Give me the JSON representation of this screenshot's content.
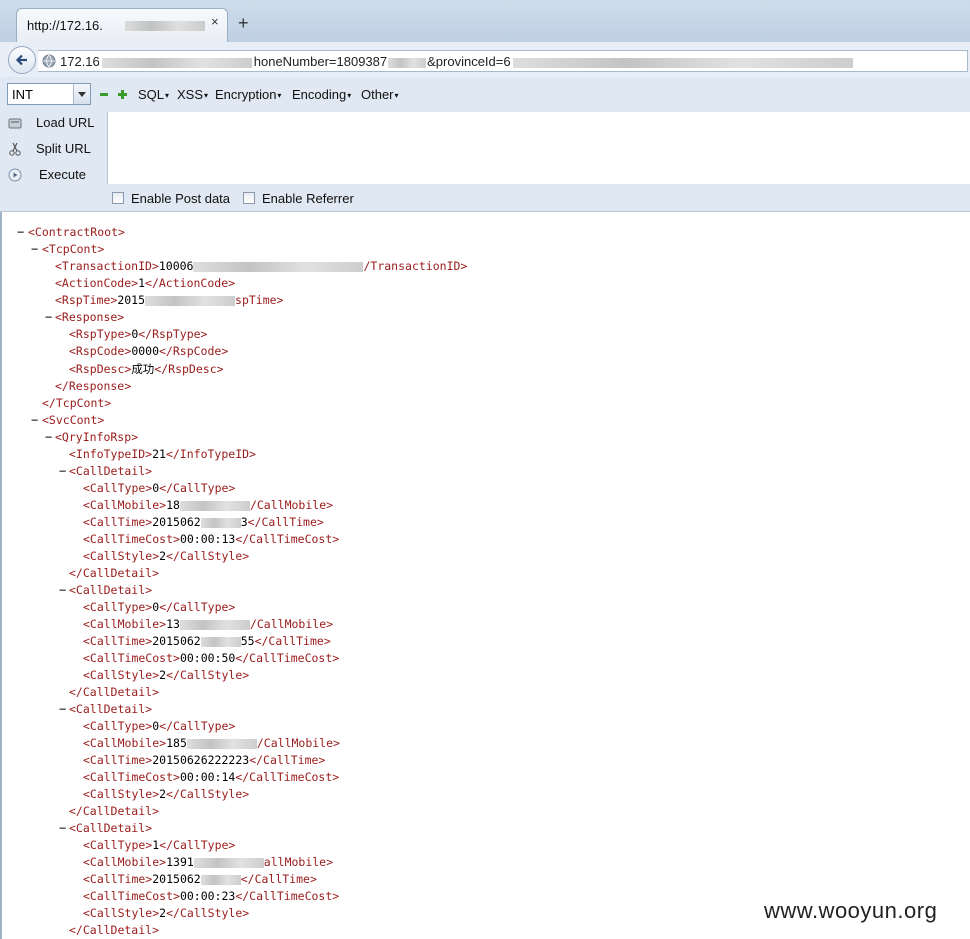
{
  "tab": {
    "title": "http://172.16.",
    "close": "×",
    "new_tab": "+"
  },
  "nav": {
    "url_prefix": "172.16",
    "url_middle": "honeNumber=1809387",
    "url_suffix": "&provinceId=6"
  },
  "hackbar": {
    "select_value": "INT",
    "menus": [
      "SQL",
      "XSS",
      "Encryption",
      "Encoding",
      "Other"
    ],
    "load_url": "Load URL",
    "split_url": "Split URL",
    "execute": "Execute",
    "enable_post": "Enable Post data",
    "enable_referrer": "Enable Referrer"
  },
  "xml": {
    "contract_root_open": "<ContractRoot>",
    "tcp_cont_open": "<TcpCont>",
    "transaction_id": {
      "open": "<TransactionID>",
      "value": "10006",
      "close": "/TransactionID>"
    },
    "action_code": {
      "open": "<ActionCode>",
      "value": "1",
      "close": "</ActionCode>"
    },
    "rsp_time": {
      "open": "<RspTime>",
      "value": "2015",
      "close": "spTime>"
    },
    "response_open": "<Response>",
    "rsp_type": {
      "open": "<RspType>",
      "value": "0",
      "close": "</RspType>"
    },
    "rsp_code": {
      "open": "<RspCode>",
      "value": "0000",
      "close": "</RspCode>"
    },
    "rsp_desc": {
      "open": "<RspDesc>",
      "value": "成功",
      "close": "</RspDesc>"
    },
    "response_close": "</Response>",
    "tcp_cont_close": "</TcpCont>",
    "svc_cont_open": "<SvcCont>",
    "qry_info_rsp_open": "<QryInfoRsp>",
    "info_type_id": {
      "open": "<InfoTypeID>",
      "value": "21",
      "close": "</InfoTypeID>"
    },
    "call_details": [
      {
        "call_type": "0",
        "mobile_prefix": "18",
        "mobile_close": "/CallMobile>",
        "call_time": "2015062",
        "call_time_tail": "3",
        "cost": "00:00:13",
        "style": "2"
      },
      {
        "call_type": "0",
        "mobile_prefix": "13",
        "mobile_close": "/CallMobile>",
        "call_time": "2015062",
        "call_time_tail": "55",
        "cost": "00:00:50",
        "style": "2"
      },
      {
        "call_type": "0",
        "mobile_prefix": "185",
        "mobile_close": "/CallMobile>",
        "call_time": "20150626222223",
        "call_time_tail": "",
        "cost": "00:00:14",
        "style": "2"
      },
      {
        "call_type": "1",
        "mobile_prefix": "1391",
        "mobile_close": "allMobile>",
        "call_time": "2015062",
        "call_time_tail": "",
        "cost": "00:00:23",
        "style": "2"
      }
    ]
  },
  "watermark": "www.wooyun.org"
}
